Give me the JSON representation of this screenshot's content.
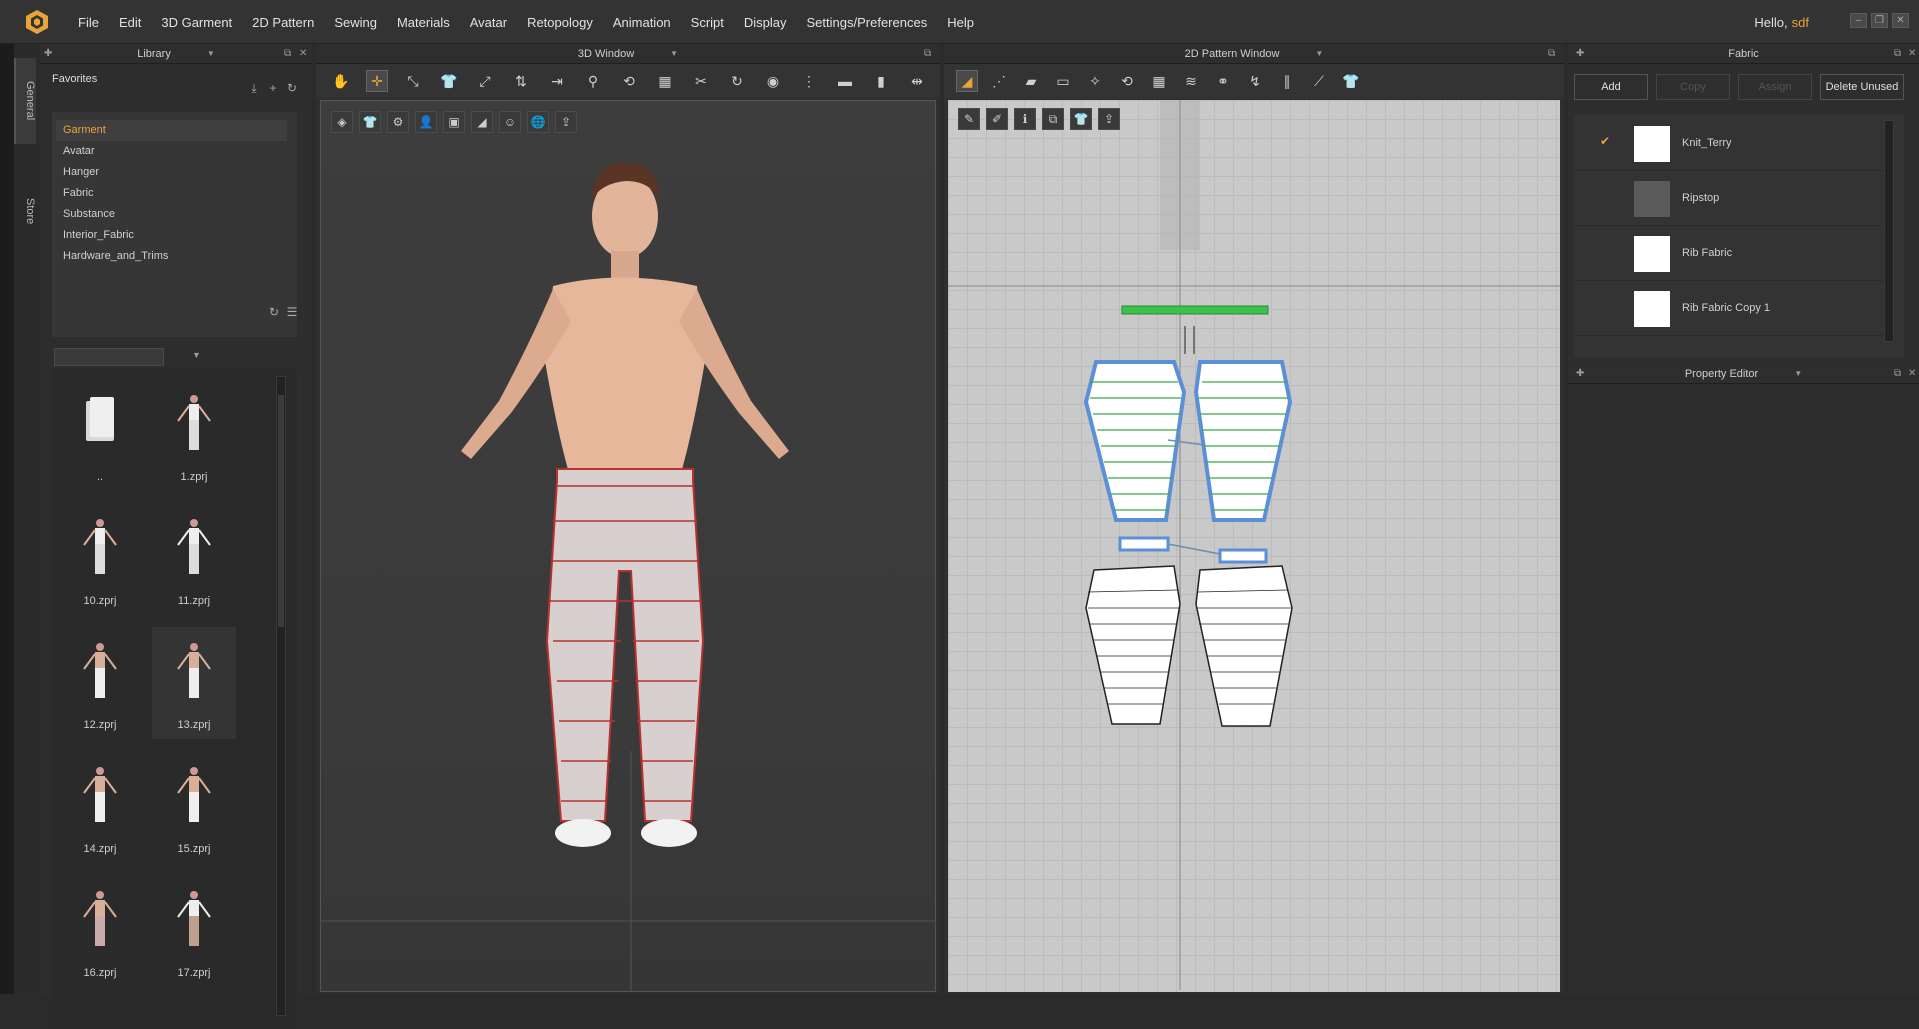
{
  "menu": [
    "File",
    "Edit",
    "3D Garment",
    "2D Pattern",
    "Sewing",
    "Materials",
    "Avatar",
    "Retopology",
    "Animation",
    "Script",
    "Display",
    "Settings/Preferences",
    "Help"
  ],
  "user": {
    "greeting": "Hello,",
    "name": "sdf"
  },
  "side_tabs": {
    "general": "General",
    "store": "Store"
  },
  "library": {
    "title": "Library",
    "favorites_label": "Favorites",
    "tree": [
      "Garment",
      "Avatar",
      "Hanger",
      "Fabric",
      "Substance",
      "Interior_Fabric",
      "Hardware_and_Trims"
    ],
    "selected": "Garment",
    "search_value": "",
    "thumbs": [
      "..",
      "1.zprj",
      "10.zprj",
      "11.zprj",
      "12.zprj",
      "13.zprj",
      "14.zprj",
      "15.zprj",
      "16.zprj",
      "17.zprj"
    ],
    "selected_thumb": "13.zprj"
  },
  "window3d": {
    "title": "3D Window"
  },
  "window2d": {
    "title": "2D Pattern Window"
  },
  "fabric": {
    "title": "Fabric",
    "buttons": {
      "add": "Add",
      "copy": "Copy",
      "assign": "Assign",
      "delete_unused": "Delete Unused"
    },
    "items": [
      {
        "name": "Knit_Terry",
        "checked": true,
        "swatch": "#ffffff"
      },
      {
        "name": "Ripstop",
        "checked": false,
        "swatch": "#5a5a5a"
      },
      {
        "name": "Rib Fabric",
        "checked": false,
        "swatch": "#ffffff"
      },
      {
        "name": "Rib Fabric Copy 1",
        "checked": false,
        "swatch": "#ffffff"
      }
    ]
  },
  "property_editor": {
    "title": "Property Editor"
  },
  "colors": {
    "accent": "#e8a33a",
    "pattern_outline": "#5b8fd6",
    "pattern_lines": "#3aa84a",
    "green_bar": "#3cc24a"
  },
  "icons": {
    "logo": "clo-logo-icon",
    "check": "check-icon"
  }
}
